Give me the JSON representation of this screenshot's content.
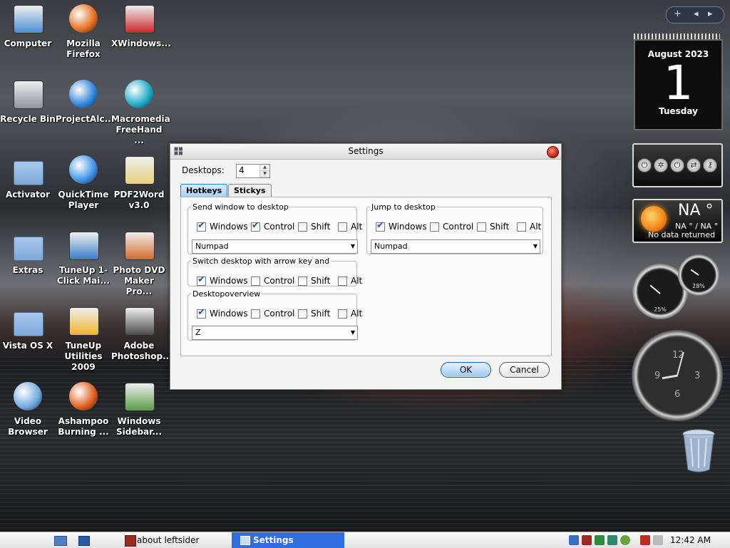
{
  "desktop_icons": [
    {
      "label": "Computer",
      "icon": "computer-monitor-icon"
    },
    {
      "label": "Mozilla Firefox",
      "icon": "firefox-icon"
    },
    {
      "label": "XWindows...",
      "icon": "xwindows-icon"
    },
    {
      "label": "Recycle Bin",
      "icon": "recycle-bin-icon"
    },
    {
      "label": "ProjectAlc...",
      "icon": "internet-explorer-icon"
    },
    {
      "label": "Macromedia FreeHand ...",
      "icon": "freehand-icon"
    },
    {
      "label": "Activator",
      "icon": "folder-icon"
    },
    {
      "label": "QuickTime Player",
      "icon": "quicktime-icon"
    },
    {
      "label": "PDF2Word v3.0",
      "icon": "pdf2word-icon"
    },
    {
      "label": "Extras",
      "icon": "folder-icon"
    },
    {
      "label": "TuneUp 1-Click Mai...",
      "icon": "tuneup-maintenance-icon"
    },
    {
      "label": "Photo DVD Maker Pro...",
      "icon": "photo-dvd-icon"
    },
    {
      "label": "Vista OS X",
      "icon": "folder-icon"
    },
    {
      "label": "TuneUp Utilities 2009",
      "icon": "tuneup-utilities-icon"
    },
    {
      "label": "Adobe Photoshop...",
      "icon": "lightroom-icon"
    },
    {
      "label": "Video Browser",
      "icon": "magnifier-icon"
    },
    {
      "label": "Ashampoo Burning ...",
      "icon": "ashampoo-icon"
    },
    {
      "label": "Windows Sidebar...",
      "icon": "windows-sidebar-icon"
    }
  ],
  "dialog": {
    "title": "Settings",
    "desktops_label": "Desktops:",
    "desktops_value": "4",
    "tabs": [
      "Hotkeys",
      "Stickys"
    ],
    "active_tab": "Hotkeys",
    "groups": {
      "send_window": {
        "title": "Send window to desktop",
        "options": [
          {
            "label": "Windows",
            "checked": true
          },
          {
            "label": "Control",
            "checked": true
          },
          {
            "label": "Shift",
            "checked": false
          },
          {
            "label": "Alt",
            "checked": false
          }
        ],
        "select": "Numpad"
      },
      "jump": {
        "title": "Jump to desktop",
        "options": [
          {
            "label": "Windows",
            "checked": true
          },
          {
            "label": "Control",
            "checked": false
          },
          {
            "label": "Shift",
            "checked": false
          },
          {
            "label": "Alt",
            "checked": false
          }
        ],
        "select": "Numpad"
      },
      "switch_arrow": {
        "title": "Switch desktop with arrow key and",
        "options": [
          {
            "label": "Windows",
            "checked": true
          },
          {
            "label": "Control",
            "checked": false
          },
          {
            "label": "Shift",
            "checked": false
          },
          {
            "label": "Alt",
            "checked": false
          }
        ]
      },
      "overview": {
        "title": "Desktopoverview",
        "options": [
          {
            "label": "Windows",
            "checked": true
          },
          {
            "label": "Control",
            "checked": false
          },
          {
            "label": "Shift",
            "checked": false
          },
          {
            "label": "Alt",
            "checked": false
          }
        ],
        "select": "Z"
      }
    },
    "ok_label": "OK",
    "cancel_label": "Cancel"
  },
  "gadgets": {
    "calendar": {
      "month_year": "August 2023",
      "day": "1",
      "weekday": "Tuesday"
    },
    "weather": {
      "temp": "NA °",
      "range": "NA ° / NA °",
      "note": "No data returned"
    },
    "meter_big": "25%",
    "meter_small": "28%",
    "clock_numbers": [
      "12",
      "3",
      "6",
      "9"
    ]
  },
  "taskbar": {
    "tasks": [
      {
        "label": "about leftsider",
        "active": false
      },
      {
        "label": "Settings",
        "active": true
      }
    ],
    "time": "12:42 AM"
  },
  "colors": {
    "task_active": "#2f6ee0",
    "ok_button": "#9cc7ef",
    "tab_active": "#a7d0f5"
  }
}
